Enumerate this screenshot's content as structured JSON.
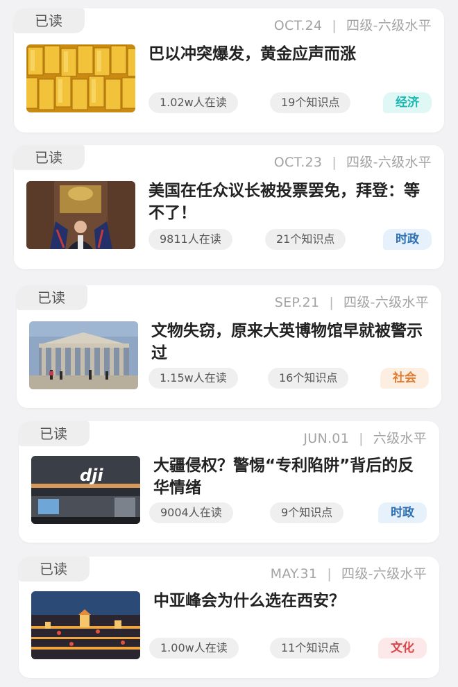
{
  "articles": [
    {
      "read_label": "已读",
      "date": "OCT.24",
      "level": "四级-六级水平",
      "title": "巴以冲突爆发，黄金应声而涨",
      "readers": "1.02w人在读",
      "points": "19个知识点",
      "tag": "经济",
      "tag_color": "#1ab7b0",
      "tag_bg": "#dff7f5",
      "image": "gold-bars-image"
    },
    {
      "read_label": "已读",
      "date": "OCT.23",
      "level": "四级-六级水平",
      "title": "美国在任众议长被投票罢免，拜登：等不了！",
      "readers": "9811人在读",
      "points": "21个知识点",
      "tag": "时政",
      "tag_color": "#2d6fb3",
      "tag_bg": "#e6f1fb",
      "image": "speaker-podium-image"
    },
    {
      "read_label": "已读",
      "date": "SEP.21",
      "level": "四级-六级水平",
      "title": "文物失窃，原来大英博物馆早就被警示过",
      "readers": "1.15w人在读",
      "points": "16个知识点",
      "tag": "社会",
      "tag_color": "#e07a2e",
      "tag_bg": "#fdeee2",
      "image": "british-museum-image"
    },
    {
      "read_label": "已读",
      "date": "JUN.01",
      "level": "六级水平",
      "title": "大疆侵权？警惕“专利陷阱”背后的反华情绪",
      "readers": "9004人在读",
      "points": "9个知识点",
      "tag": "时政",
      "tag_color": "#2d6fb3",
      "tag_bg": "#e6f1fb",
      "image": "dji-store-image"
    },
    {
      "read_label": "已读",
      "date": "MAY.31",
      "level": "四级-六级水平",
      "title": "中亚峰会为什么选在西安？",
      "readers": "1.00w人在读",
      "points": "11个知识点",
      "tag": "文化",
      "tag_color": "#d9464a",
      "tag_bg": "#fce8e8",
      "image": "xian-night-image"
    }
  ]
}
